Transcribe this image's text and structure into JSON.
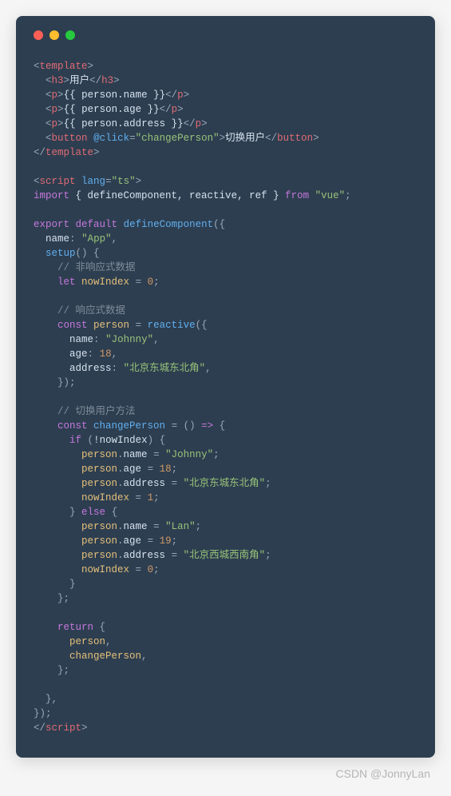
{
  "watermark": "CSDN @JonnyLan",
  "code": {
    "line1_tag": "template",
    "line2_tag": "h3",
    "line2_text": "用户",
    "line3_tag": "p",
    "line3_expr": "{{ person.name }}",
    "line4_tag": "p",
    "line4_expr": "{{ person.age }}",
    "line5_tag": "p",
    "line5_expr": "{{ person.address }}",
    "line6_tag": "button",
    "line6_attr": "@click",
    "line6_val": "\"changePerson\"",
    "line6_text": "切换用户",
    "line7_tag": "template",
    "line9_tag": "script",
    "line9_attr": "lang",
    "line9_val": "\"ts\"",
    "line10_import": "import",
    "line10_names": "{ defineComponent, reactive, ref }",
    "line10_from": "from",
    "line10_src": "\"vue\"",
    "line12_a": "export",
    "line12_b": "default",
    "line12_fn": "defineComponent",
    "line13_k": "name",
    "line13_v": "\"App\"",
    "line14_k": "setup",
    "line15_cmt": "// 非响应式数据",
    "line16_kw": "let",
    "line16_id": "nowIndex",
    "line16_v": "0",
    "line18_cmt": "// 响应式数据",
    "line19_kw": "const",
    "line19_id": "person",
    "line19_fn": "reactive",
    "line20_k": "name",
    "line20_v": "\"Johnny\"",
    "line21_k": "age",
    "line21_v": "18",
    "line22_k": "address",
    "line22_v": "\"北京东城东北角\"",
    "line25_cmt": "// 切换用户方法",
    "line26_kw": "const",
    "line26_id": "changePerson",
    "line27_kw": "if",
    "line27_cond": "!nowIndex",
    "line28_obj": "person",
    "line28_prop": "name",
    "line28_v": "\"Johnny\"",
    "line29_obj": "person",
    "line29_prop": "age",
    "line29_v": "18",
    "line30_obj": "person",
    "line30_prop": "address",
    "line30_v": "\"北京东城东北角\"",
    "line31_id": "nowIndex",
    "line31_v": "1",
    "line32_kw": "else",
    "line33_obj": "person",
    "line33_prop": "name",
    "line33_v": "\"Lan\"",
    "line34_obj": "person",
    "line34_prop": "age",
    "line34_v": "19",
    "line35_obj": "person",
    "line35_prop": "address",
    "line35_v": "\"北京西城西南角\"",
    "line36_id": "nowIndex",
    "line36_v": "0",
    "line40_kw": "return",
    "line41_id": "person",
    "line42_id": "changePerson",
    "line47_tag": "script"
  }
}
